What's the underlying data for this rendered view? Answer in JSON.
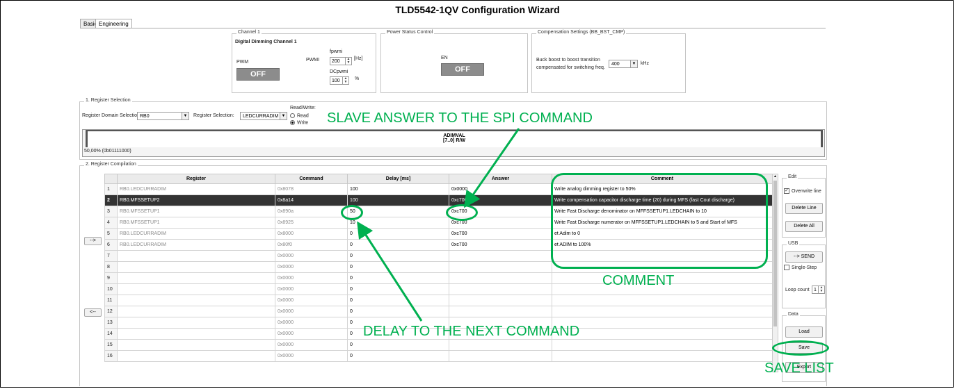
{
  "window": {
    "title": "TLD5542-1QV Configuration Wizard"
  },
  "tabs": [
    {
      "label": "Basic"
    },
    {
      "label": "Engineering"
    }
  ],
  "channel1": {
    "group_title": "Channel 1",
    "heading": "Digital Dimming Channel 1",
    "pwm_label": "PWM",
    "pwm_state": "OFF",
    "pwmi_label": "PWMI",
    "fpwmi_label": "fpwmi",
    "fpwmi_value": "200",
    "fpwmi_unit": "[Hz]",
    "dcpwmi_label": "DCpwmi",
    "dcpwmi_value": "100",
    "dcpwmi_unit": "%"
  },
  "power_status": {
    "group_title": "Power Status Control",
    "en_label": "EN",
    "en_state": "OFF"
  },
  "compensation": {
    "group_title": "Compensation Settings (BB_BST_CMP)",
    "text_line1": "Buck boost to boost transition",
    "text_line2": "compensated for switching freq.",
    "value": "400",
    "unit": "kHz"
  },
  "register_selection": {
    "group_title": "1. Register Selection",
    "domain_label": "Register Domain Selection:",
    "domain_value": "RB0",
    "register_label": "Register Selection:",
    "register_value": "LEDCURRADIM",
    "rw_label": "Read/Write:",
    "read_label": "Read",
    "write_label": "Write",
    "write_selected": true,
    "bitfield_name": "ADIMVAL",
    "bitfield_bits": "[7..0] R/W",
    "current_value": "50,00% (0b01111000)"
  },
  "register_compilation": {
    "group_title": "2. Register Compilation",
    "add_button": "-->",
    "remove_button": "<--",
    "columns": [
      "Register",
      "Command",
      "Delay [ms]",
      "Answer",
      "Comment"
    ],
    "selected_row": 2,
    "rows": [
      {
        "n": "1",
        "register": "RB0.LEDCURRADIM",
        "command": "0x8078",
        "delay": "100",
        "answer": "0x0000",
        "comment": "Write analog dimming register to 50%"
      },
      {
        "n": "2",
        "register": "RB0.MFSSETUP2",
        "command": "0x8a14",
        "delay": "100",
        "answer": "0xc700",
        "comment": "Write compensation capacitor discharge time (20) during MFS (fast Cout discharge)"
      },
      {
        "n": "3",
        "register": "RB0.MFSSETUP1",
        "command": "0x890a",
        "delay": "50",
        "answer": "0xc700",
        "comment": "Write Fast Discharge denominator on MFFSSETUP1.LEDCHAIN to 10"
      },
      {
        "n": "4",
        "register": "RB0.MFSSETUP1",
        "command": "0x8925",
        "delay": "10",
        "answer": "0xc700",
        "comment": "Write Fast Discharge numerator on MFFSSETUP1.LEDCHAIN to 5 and Start of MFS"
      },
      {
        "n": "5",
        "register": "RB0.LEDCURRADIM",
        "command": "0x8000",
        "delay": "0",
        "answer": "0xc700",
        "comment": "et Adim to 0"
      },
      {
        "n": "6",
        "register": "RB0.LEDCURRADIM",
        "command": "0x80f0",
        "delay": "0",
        "answer": "0xc700",
        "comment": "et ADIM to 100%"
      },
      {
        "n": "7",
        "register": "",
        "command": "0x0000",
        "delay": "0",
        "answer": "",
        "comment": ""
      },
      {
        "n": "8",
        "register": "",
        "command": "0x0000",
        "delay": "0",
        "answer": "",
        "comment": ""
      },
      {
        "n": "9",
        "register": "",
        "command": "0x0000",
        "delay": "0",
        "answer": "",
        "comment": ""
      },
      {
        "n": "10",
        "register": "",
        "command": "0x0000",
        "delay": "0",
        "answer": "",
        "comment": ""
      },
      {
        "n": "11",
        "register": "",
        "command": "0x0000",
        "delay": "0",
        "answer": "",
        "comment": ""
      },
      {
        "n": "12",
        "register": "",
        "command": "0x0000",
        "delay": "0",
        "answer": "",
        "comment": ""
      },
      {
        "n": "13",
        "register": "",
        "command": "0x0000",
        "delay": "0",
        "answer": "",
        "comment": ""
      },
      {
        "n": "14",
        "register": "",
        "command": "0x0000",
        "delay": "0",
        "answer": "",
        "comment": ""
      },
      {
        "n": "15",
        "register": "",
        "command": "0x0000",
        "delay": "0",
        "answer": "",
        "comment": ""
      },
      {
        "n": "16",
        "register": "",
        "command": "0x0000",
        "delay": "0",
        "answer": "",
        "comment": ""
      }
    ]
  },
  "edit": {
    "group_title": "Edit",
    "overwrite_label": "Overwrite line",
    "overwrite_checked": true,
    "delete_line": "Delete Line",
    "delete_all": "Delete All"
  },
  "usb": {
    "group_title": "USB",
    "send": "--> SEND",
    "single_step": "Single-Step",
    "loop_label": "Loop count",
    "loop_value": "1"
  },
  "data_group": {
    "group_title": "Data",
    "load": "Load",
    "save": "Save",
    "export": "Export"
  },
  "annotations": {
    "slave_answer": "SLAVE ANSWER TO THE SPI COMMAND",
    "comment": "COMMENT",
    "delay": "DELAY TO THE NEXT COMMAND",
    "save_list": "SAVE LIST",
    "color": "#00b050"
  },
  "colors": {
    "selected_row": "#333333",
    "off_button": "#8c8c8c"
  }
}
